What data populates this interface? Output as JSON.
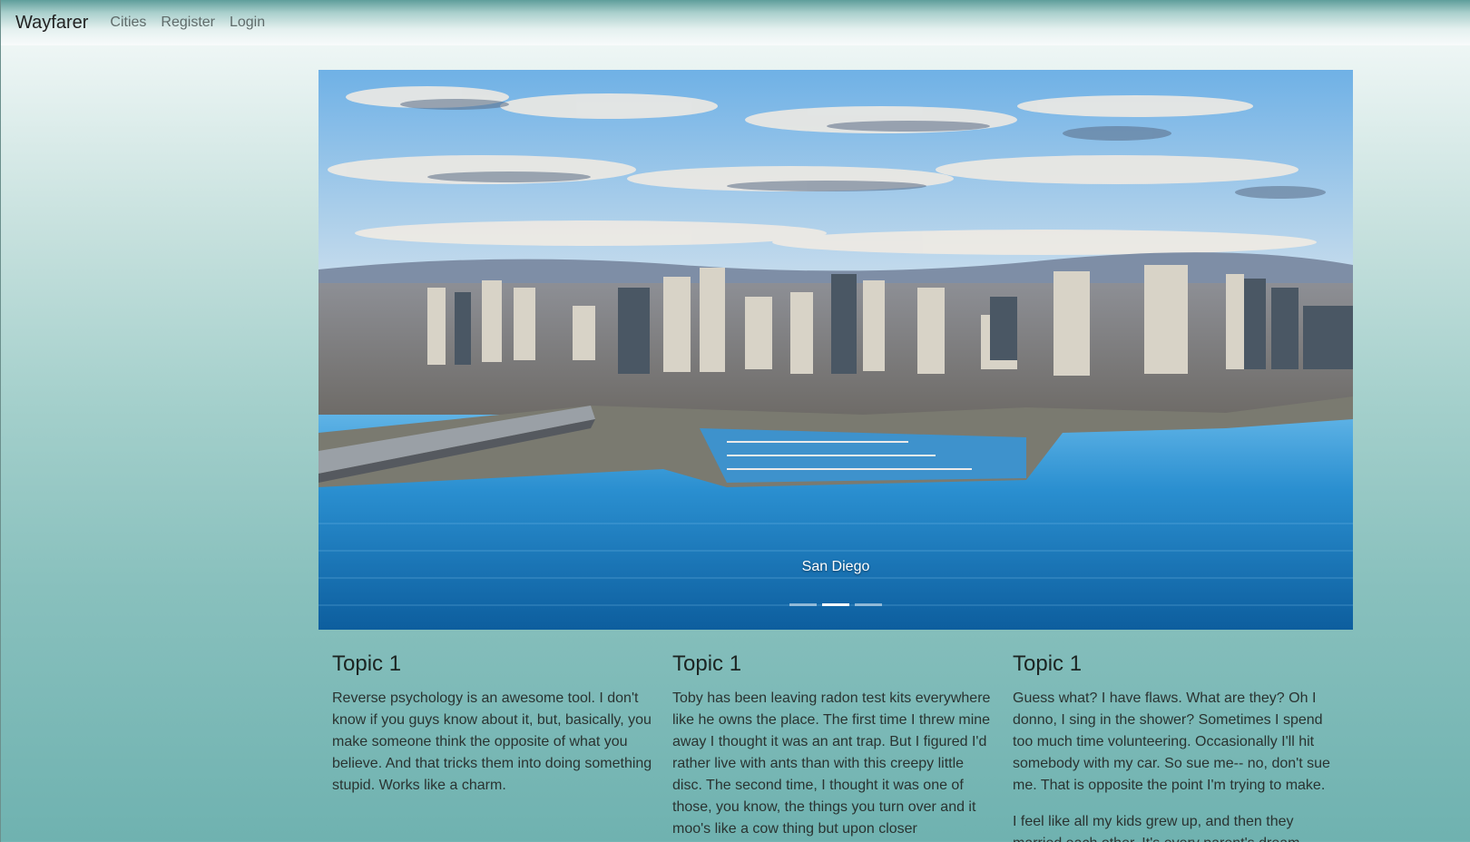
{
  "navbar": {
    "brand": "Wayfarer",
    "links": [
      "Cities",
      "Register",
      "Login"
    ]
  },
  "carousel": {
    "caption": "San Diego",
    "indicator_count": 3,
    "active_indicator": 2
  },
  "cards": [
    {
      "title": "Topic 1",
      "paragraphs": [
        "Reverse psychology is an awesome tool. I don't know if you guys know about it, but, basically, you make someone think the opposite of what you believe. And that tricks them into doing something stupid. Works like a charm."
      ]
    },
    {
      "title": "Topic 1",
      "paragraphs": [
        "Toby has been leaving radon test kits everywhere like he owns the place. The first time I threw mine away I thought it was an ant trap. But I figured I'd rather live with ants than with this creepy little disc. The second time, I thought it was one of those, you know, the things you turn over and it moo's like a cow thing but upon closer"
      ]
    },
    {
      "title": "Topic 1",
      "paragraphs": [
        "Guess what? I have flaws. What are they? Oh I donno, I sing in the shower? Sometimes I spend too much time volunteering. Occasionally I'll hit somebody with my car. So sue me-- no, don't sue me. That is opposite the point I'm trying to make.",
        "I feel like all my kids grew up, and then they married each other. It's every parent's dream."
      ]
    }
  ]
}
